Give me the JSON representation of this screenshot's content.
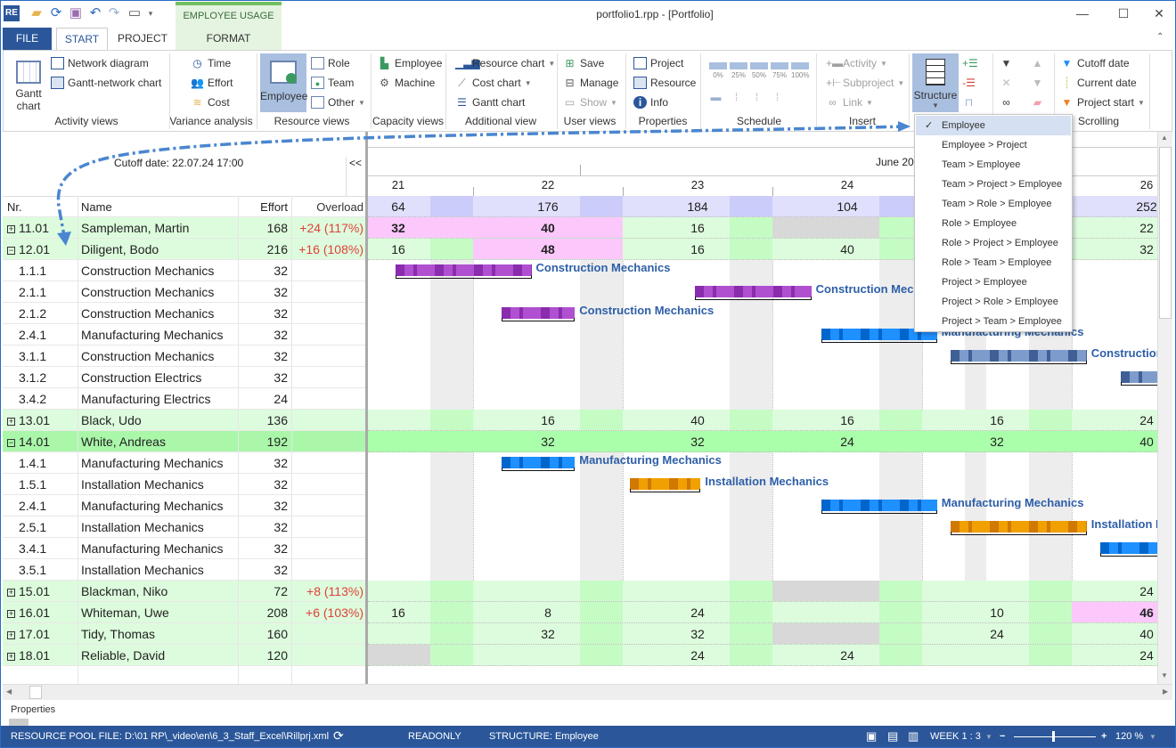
{
  "window": {
    "title": "portfolio1.rpp - [Portfolio]",
    "app_icon": "RE",
    "controls": [
      "minimize-icon",
      "maximize-icon",
      "close-icon"
    ]
  },
  "quick_access": [
    "app-icon",
    "open-folder-icon",
    "refresh-icon",
    "save-icon",
    "undo-icon",
    "redo-icon",
    "window-icon",
    "customize-dropdown-icon"
  ],
  "tabs": {
    "file": "FILE",
    "start": "START",
    "project": "PROJECT",
    "context_group": "EMPLOYEE USAGE",
    "format": "FORMAT"
  },
  "ribbon": {
    "groups": [
      "Activity views",
      "Variance analysis",
      "Resource views",
      "Capacity views",
      "Additional view",
      "User views",
      "Properties",
      "Schedule",
      "Insert",
      "Scrolling"
    ],
    "gantt_chart": "Gantt chart",
    "network_diagram": "Network diagram",
    "gantt_network": "Gantt-network chart",
    "time": "Time",
    "effort": "Effort",
    "cost": "Cost",
    "employee": "Employee",
    "role": "Role",
    "team": "Team",
    "other": "Other",
    "cap_employee": "Employee",
    "machine": "Machine",
    "resource_chart": "Resource chart",
    "cost_chart": "Cost chart",
    "gantt_chart2": "Gantt chart",
    "save": "Save",
    "manage": "Manage",
    "show": "Show",
    "project": "Project",
    "resource": "Resource",
    "info": "Info",
    "progress": [
      "0%",
      "25%",
      "50%",
      "75%",
      "100%"
    ],
    "activity": "Activity",
    "subproject": "Subproject",
    "link": "Link",
    "structure": "Structure",
    "cutoff_date": "Cutoff date",
    "current_date": "Current date",
    "project_start": "Project start"
  },
  "structure_menu": {
    "selected": "Employee",
    "items": [
      "Employee",
      "Employee > Project",
      "Team > Employee",
      "Team > Project > Employee",
      "Team > Role > Employee",
      "Role > Employee",
      "Role > Project > Employee",
      "Role > Team > Employee",
      "Project > Employee",
      "Project > Role > Employee",
      "Project > Team > Employee"
    ]
  },
  "table": {
    "cutoff": "Cutoff date: 22.07.24 17:00",
    "collapse": "<<",
    "headers": {
      "nr": "Nr.",
      "name": "Name",
      "effort": "Effort",
      "overload": "Overload"
    },
    "rows": [
      {
        "nr": "11.01",
        "name": "Sampleman, Martin",
        "effort": "168",
        "overload": "+24 (117%)",
        "type": "group",
        "exp": "+"
      },
      {
        "nr": "12.01",
        "name": "Diligent, Bodo",
        "effort": "216",
        "overload": "+16 (108%)",
        "type": "group",
        "exp": "-"
      },
      {
        "nr": "1.1.1",
        "name": "Construction Mechanics",
        "effort": "32",
        "overload": "",
        "type": "task"
      },
      {
        "nr": "2.1.1",
        "name": "Construction Mechanics",
        "effort": "32",
        "overload": "",
        "type": "task"
      },
      {
        "nr": "2.1.2",
        "name": "Construction Mechanics",
        "effort": "32",
        "overload": "",
        "type": "task"
      },
      {
        "nr": "2.4.1",
        "name": "Manufacturing Mechanics",
        "effort": "32",
        "overload": "",
        "type": "task"
      },
      {
        "nr": "3.1.1",
        "name": "Construction Mechanics",
        "effort": "32",
        "overload": "",
        "type": "task"
      },
      {
        "nr": "3.1.2",
        "name": "Construction Electrics",
        "effort": "32",
        "overload": "",
        "type": "task"
      },
      {
        "nr": "3.4.2",
        "name": "Manufacturing Electrics",
        "effort": "24",
        "overload": "",
        "type": "task"
      },
      {
        "nr": "13.01",
        "name": "Black, Udo",
        "effort": "136",
        "overload": "",
        "type": "group",
        "exp": "+"
      },
      {
        "nr": "14.01",
        "name": "White, Andreas",
        "effort": "192",
        "overload": "",
        "type": "selected",
        "exp": "-"
      },
      {
        "nr": "1.4.1",
        "name": "Manufacturing Mechanics",
        "effort": "32",
        "overload": "",
        "type": "task"
      },
      {
        "nr": "1.5.1",
        "name": "Installation Mechanics",
        "effort": "32",
        "overload": "",
        "type": "task"
      },
      {
        "nr": "2.4.1",
        "name": "Manufacturing Mechanics",
        "effort": "32",
        "overload": "",
        "type": "task"
      },
      {
        "nr": "2.5.1",
        "name": "Installation Mechanics",
        "effort": "32",
        "overload": "",
        "type": "task"
      },
      {
        "nr": "3.4.1",
        "name": "Manufacturing Mechanics",
        "effort": "32",
        "overload": "",
        "type": "task"
      },
      {
        "nr": "3.5.1",
        "name": "Installation Mechanics",
        "effort": "32",
        "overload": "",
        "type": "task"
      },
      {
        "nr": "15.01",
        "name": "Blackman, Niko",
        "effort": "72",
        "overload": "+8 (113%)",
        "type": "group",
        "exp": "+"
      },
      {
        "nr": "16.01",
        "name": "Whiteman, Uwe",
        "effort": "208",
        "overload": "+6 (103%)",
        "type": "group",
        "exp": "+"
      },
      {
        "nr": "17.01",
        "name": "Tidy, Thomas",
        "effort": "160",
        "overload": "",
        "type": "group",
        "exp": "+"
      },
      {
        "nr": "18.01",
        "name": "Reliable, David",
        "effort": "120",
        "overload": "",
        "type": "group",
        "exp": "+"
      }
    ]
  },
  "timeline": {
    "month": "June 20",
    "days": [
      "21",
      "22",
      "23",
      "24",
      "25",
      "26"
    ],
    "totals": [
      "64",
      "176",
      "184",
      "104",
      "",
      "252"
    ],
    "cells": [
      [
        [
          "32",
          "o"
        ],
        [
          "40",
          "o"
        ],
        [
          "16",
          ""
        ],
        [
          "",
          "n"
        ],
        [
          "",
          ""
        ],
        [
          "22",
          ""
        ]
      ],
      [
        [
          "16",
          ""
        ],
        [
          "48",
          "o"
        ],
        [
          "16",
          ""
        ],
        [
          "40",
          ""
        ],
        [
          "",
          ""
        ],
        [
          "32",
          ""
        ]
      ],
      null,
      null,
      null,
      null,
      null,
      null,
      null,
      [
        [
          "",
          ""
        ],
        [
          "16",
          ""
        ],
        [
          "40",
          ""
        ],
        [
          "16",
          ""
        ],
        [
          "16",
          ""
        ],
        [
          "24",
          ""
        ]
      ],
      [
        [
          "",
          ""
        ],
        [
          "32",
          ""
        ],
        [
          "32",
          ""
        ],
        [
          "24",
          ""
        ],
        [
          "32",
          ""
        ],
        [
          "40",
          ""
        ]
      ],
      null,
      null,
      null,
      null,
      null,
      null,
      [
        [
          "",
          ""
        ],
        [
          "",
          ""
        ],
        [
          "",
          ""
        ],
        [
          "",
          "n"
        ],
        [
          "",
          ""
        ],
        [
          "24",
          ""
        ]
      ],
      [
        [
          "16",
          ""
        ],
        [
          "8",
          ""
        ],
        [
          "24",
          ""
        ],
        [
          "",
          ""
        ],
        [
          "10",
          ""
        ],
        [
          "46",
          "o"
        ]
      ],
      [
        [
          "",
          ""
        ],
        [
          "32",
          ""
        ],
        [
          "32",
          ""
        ],
        [
          "",
          "n"
        ],
        [
          "24",
          ""
        ],
        [
          "40",
          ""
        ]
      ],
      [
        [
          "",
          "n"
        ],
        [
          "",
          ""
        ],
        [
          "24",
          ""
        ],
        [
          "24",
          ""
        ],
        [
          "",
          ""
        ],
        [
          "24",
          ""
        ]
      ]
    ],
    "bars": [
      {
        "row": 2,
        "start": 21.48,
        "end": 22.39,
        "color": "#b050d0",
        "dark": "#8a2cae",
        "label": "Construction Mechanics"
      },
      {
        "row": 3,
        "start": 23.48,
        "end": 24.26,
        "color": "#b050d0",
        "dark": "#8a2cae",
        "label": "Construction Mechanics"
      },
      {
        "row": 4,
        "start": 22.19,
        "end": 22.68,
        "color": "#b050d0",
        "dark": "#8a2cae",
        "label": "Construction Mechanics"
      },
      {
        "row": 5,
        "start": 24.33,
        "end": 25.1,
        "color": "#1e90ff",
        "dark": "#0066cc",
        "label": "Manufacturing Mechanics"
      },
      {
        "row": 6,
        "start": 25.19,
        "end": 26.1,
        "color": "#7d9ccc",
        "dark": "#3f5f96",
        "label": "Construction Mechanics"
      },
      {
        "row": 7,
        "start": 26.33,
        "end": 26.6,
        "color": "#7d9ccc",
        "dark": "#3f5f96",
        "label": ""
      },
      {
        "row": 11,
        "start": 22.19,
        "end": 22.68,
        "color": "#1e90ff",
        "dark": "#0066cc",
        "label": "Manufacturing Mechanics"
      },
      {
        "row": 12,
        "start": 23.05,
        "end": 23.52,
        "color": "#f0a000",
        "dark": "#d07800",
        "label": "Installation Mechanics"
      },
      {
        "row": 13,
        "start": 24.33,
        "end": 25.1,
        "color": "#1e90ff",
        "dark": "#0066cc",
        "label": "Manufacturing Mechanics"
      },
      {
        "row": 14,
        "start": 25.19,
        "end": 26.1,
        "color": "#f0a000",
        "dark": "#d07800",
        "label": "Installation Mechanics"
      },
      {
        "row": 15,
        "start": 26.19,
        "end": 26.6,
        "color": "#1e90ff",
        "dark": "#0066cc",
        "label": ""
      }
    ]
  },
  "bottom": {
    "properties": "Properties"
  },
  "status": {
    "file": "RESOURCE POOL FILE: D:\\01 RP\\_video\\en\\6_3_Staff_Excel\\Rillprj.xml",
    "readonly": "READONLY",
    "structure": "STRUCTURE: Employee",
    "scale": "WEEK 1 : 3",
    "zoom": "120 %",
    "zoom_level": 120
  },
  "colors": {
    "accent": "#2b579a",
    "overload": "#e0403a",
    "group_row": "#ddfcdd",
    "selected_row": "#aaf7aa",
    "overload_cell": "#fcc8fc",
    "total_row": "#e0e0fc"
  }
}
